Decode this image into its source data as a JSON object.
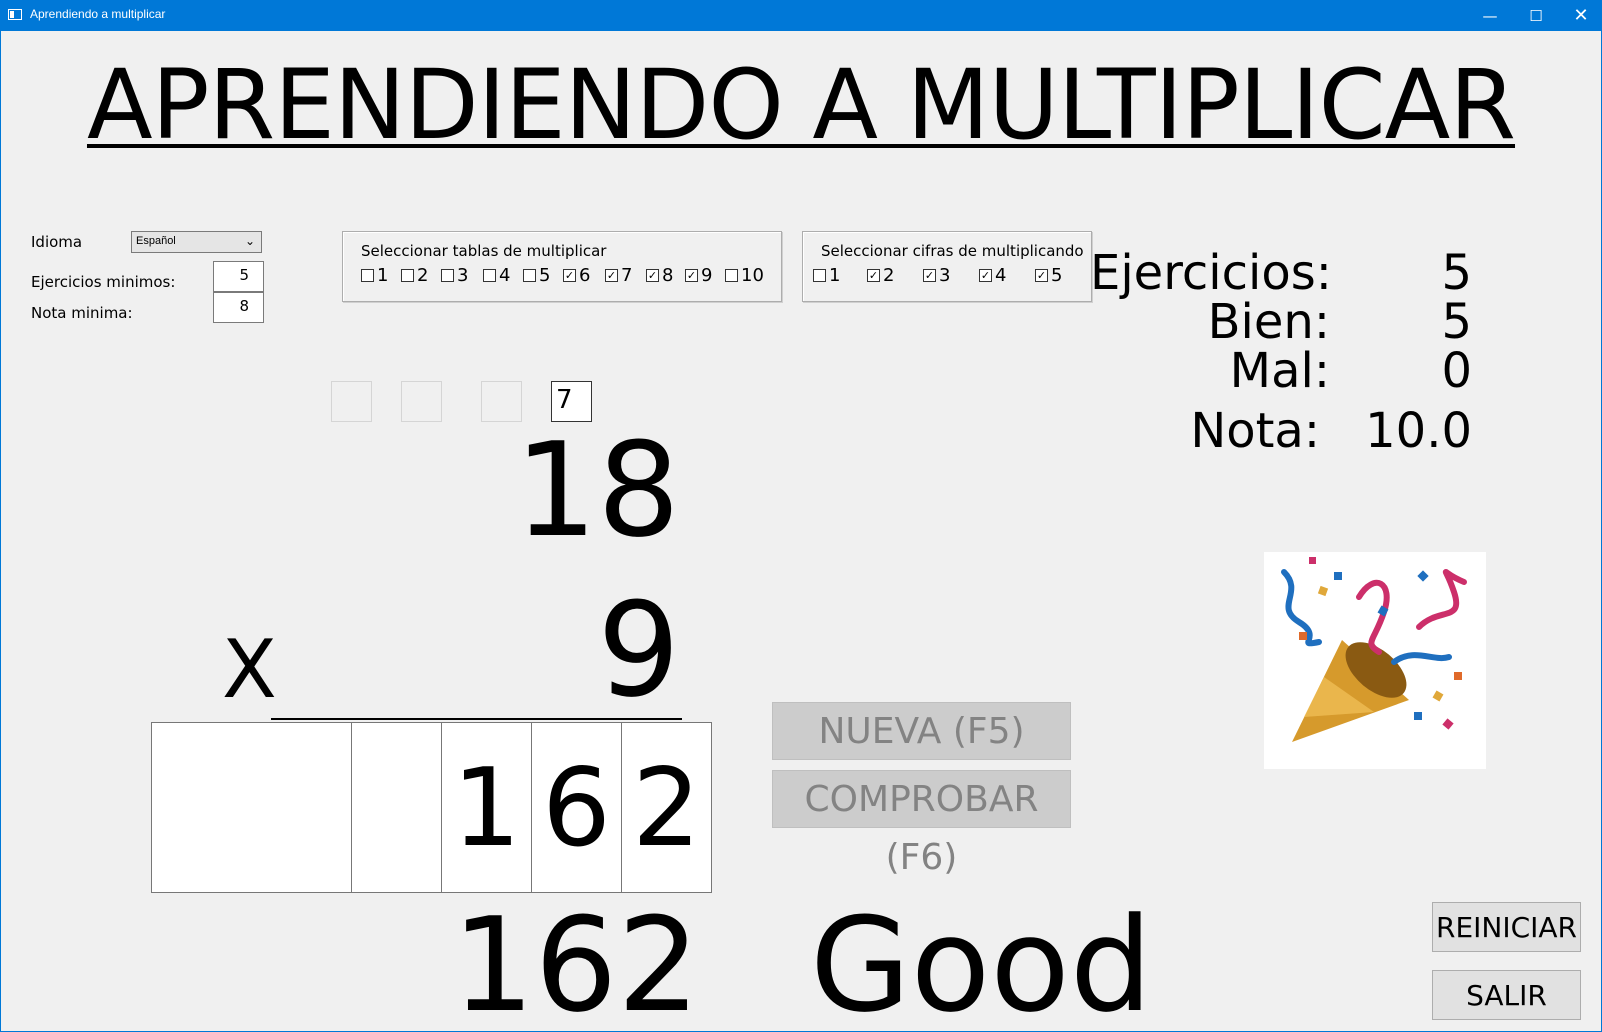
{
  "window": {
    "title": "Aprendiendo a multiplicar"
  },
  "header": {
    "title": "APRENDIENDO A MULTIPLICAR"
  },
  "settings": {
    "idioma_label": "Idioma",
    "idioma_value": "Español",
    "ejercicios_label": "Ejercicios minimos:",
    "ejercicios_value": "5",
    "nota_label": "Nota minima:",
    "nota_value": "8"
  },
  "tablas": {
    "title": "Seleccionar tablas de multiplicar",
    "items": [
      {
        "label": "1",
        "checked": false
      },
      {
        "label": "2",
        "checked": false
      },
      {
        "label": "3",
        "checked": false
      },
      {
        "label": "4",
        "checked": false
      },
      {
        "label": "5",
        "checked": false
      },
      {
        "label": "6",
        "checked": true
      },
      {
        "label": "7",
        "checked": true
      },
      {
        "label": "8",
        "checked": true
      },
      {
        "label": "9",
        "checked": true
      },
      {
        "label": "10",
        "checked": false
      }
    ]
  },
  "cifras": {
    "title": "Seleccionar cifras de multiplicando",
    "items": [
      {
        "label": "1",
        "checked": false
      },
      {
        "label": "2",
        "checked": true
      },
      {
        "label": "3",
        "checked": true
      },
      {
        "label": "4",
        "checked": true
      },
      {
        "label": "5",
        "checked": true
      }
    ]
  },
  "stats": {
    "ejercicios_label": "Ejercicios:",
    "ejercicios_value": "5",
    "bien_label": "Bien:",
    "bien_value": "5",
    "mal_label": "Mal:",
    "mal_value": "0",
    "nota_label": "Nota:",
    "nota_value": "10.0"
  },
  "exercise": {
    "carry_value": "7",
    "multiplicand": "18",
    "multiplier": "9",
    "operator": "X",
    "answer_digits": [
      "",
      "",
      "1",
      "6",
      "2"
    ],
    "correct_result": "162",
    "feedback": "Good"
  },
  "buttons": {
    "nueva": "NUEVA (F5)",
    "comprobar": "COMPROBAR (F6)",
    "reiniciar": "REINICIAR",
    "salir": "SALIR"
  },
  "icons": {
    "celebration": "party-popper-icon",
    "window_min": "minimize-icon",
    "window_max": "maximize-icon",
    "window_close": "close-icon"
  },
  "colors": {
    "titlebar": "#0078d7",
    "background": "#f0f0f0",
    "disabled_button": "#cccccc"
  }
}
